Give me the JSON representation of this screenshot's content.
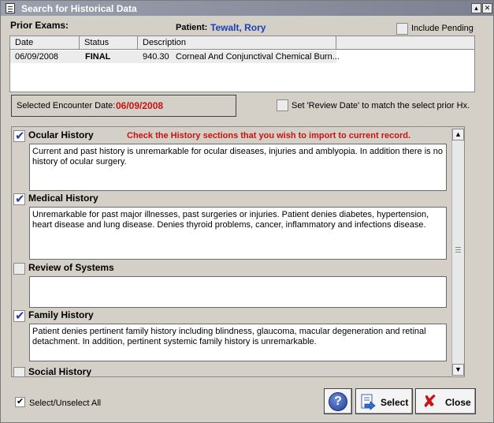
{
  "window": {
    "title": "Search for Historical Data",
    "restore_glyph": "▴",
    "close_glyph": "✕"
  },
  "prior_exams": {
    "label": "Prior Exams:",
    "patient_label": "Patient:",
    "patient_name": "Tewalt, Rory",
    "include_pending_label": "Include Pending",
    "include_pending_checked": false,
    "columns": [
      "Date",
      "Status",
      "Description"
    ],
    "rows": [
      {
        "date": "06/09/2008",
        "status": "FINAL",
        "code": "940.30",
        "description": "Corneal And Conjunctival Chemical Burn..."
      }
    ]
  },
  "encounter": {
    "label": "Selected Encounter Date:",
    "date": "06/09/2008"
  },
  "review_date": {
    "label": "Set 'Review Date' to match the select prior Hx.",
    "checked": false
  },
  "instruction": "Check the History sections that you wish to import to current record.",
  "sections": [
    {
      "title": "Ocular History",
      "checked": true,
      "text": "Current and past history is unremarkable for ocular diseases, injuries and amblyopia.   In addition there is no history of ocular surgery."
    },
    {
      "title": "Medical History",
      "checked": true,
      "text": "Unremarkable for past major illnesses, past surgeries or injuries.    Patient denies diabetes, hypertension, heart disease and lung disease.  Denies thyroid problems, cancer, inflammatory and infections disease."
    },
    {
      "title": "Review of Systems",
      "checked": false,
      "text": ""
    },
    {
      "title": "Family History",
      "checked": true,
      "text": "Patient denies pertinent family history including blindness, glaucoma, macular degeneration and retinal detachment. In addition, pertinent systemic family history is unremarkable."
    },
    {
      "title": "Social History",
      "checked": false,
      "text": ""
    }
  ],
  "select_all": {
    "label": "Select/Unselect All",
    "checked": true
  },
  "buttons": {
    "help_glyph": "?",
    "select_label": "Select",
    "close_label": "Close"
  },
  "icons": {
    "check": "✔",
    "scroll_up": "▲",
    "scroll_down": "▼",
    "close_x": "✘"
  },
  "colors": {
    "patient_name": "#1a3fb5",
    "encounter_date": "#cc1111",
    "instruction": "#cc1111"
  }
}
